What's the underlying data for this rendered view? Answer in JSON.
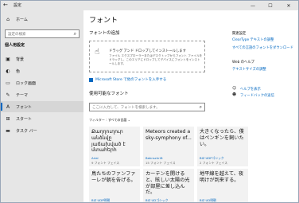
{
  "window": {
    "back_glyph": "←",
    "title": "設定",
    "minimize": "—",
    "maximize": "☐",
    "close": "✕"
  },
  "sidebar": {
    "home": "ホーム",
    "search_placeholder": "設定の検索",
    "section_title": "個人用設定",
    "items": [
      {
        "label": "背景"
      },
      {
        "label": "色"
      },
      {
        "label": "ロック画面"
      },
      {
        "label": "テーマ"
      },
      {
        "label": "フォント"
      },
      {
        "label": "スタート"
      },
      {
        "label": "タスク バー"
      }
    ]
  },
  "main": {
    "title": "フォント",
    "add_heading": "フォントの追加",
    "drop_title": "ドラッグ アンド ドロップしてインストールします",
    "drop_desc": "ファイル エクスプローラーまたはデスクトップからフォント ファイルをドラッグし、このエリアにドロップしてデバイスにフォントをインストールします。",
    "store_link": "Microsoft Store で他のフォントを入手する",
    "available_heading": "使用可能なフォント",
    "font_search_placeholder": "ここに入力して、フォントを検索します。",
    "filter_label": "フィルター :",
    "filter_value": "すべての言語",
    "fonts": [
      {
        "preview": "Քաղղուղուր անձնվը յաճախված է մտահերհ",
        "name": "Arial",
        "count": "9 フォント フェイス"
      },
      {
        "preview": "Meteors created a sky-symphony of...",
        "name": "Bahnschrift",
        "count": "15 フォント フェイス"
      },
      {
        "preview": "大きくなったら、僕はペンギンを飼いたい。",
        "name": "BIZ UDPゴシック",
        "count": "2 フォント フェイス"
      },
      {
        "preview": "鳥たちのファンファーレが朝を告げる。",
        "name": "BIZ UDP明朝",
        "count": ""
      },
      {
        "preview": "カーテンを開けると、眩しい太陽の光が部屋に差し込んだ。",
        "name": "BIZ UDゴシック",
        "count": ""
      },
      {
        "preview": "地平線を越えて、夜明けが到来する。",
        "name": "BIZ UD明朝",
        "count": ""
      }
    ]
  },
  "right": {
    "related_heading": "関連設定",
    "cleartype": "ClearType テキストの調整",
    "download_all": "すべての言語のフォントをダウンロード",
    "web_help_heading": "Web のヘルプ",
    "text_size": "テキストサイズの調整",
    "get_help": "ヘルプを表示",
    "feedback": "フィードバックの送信"
  }
}
